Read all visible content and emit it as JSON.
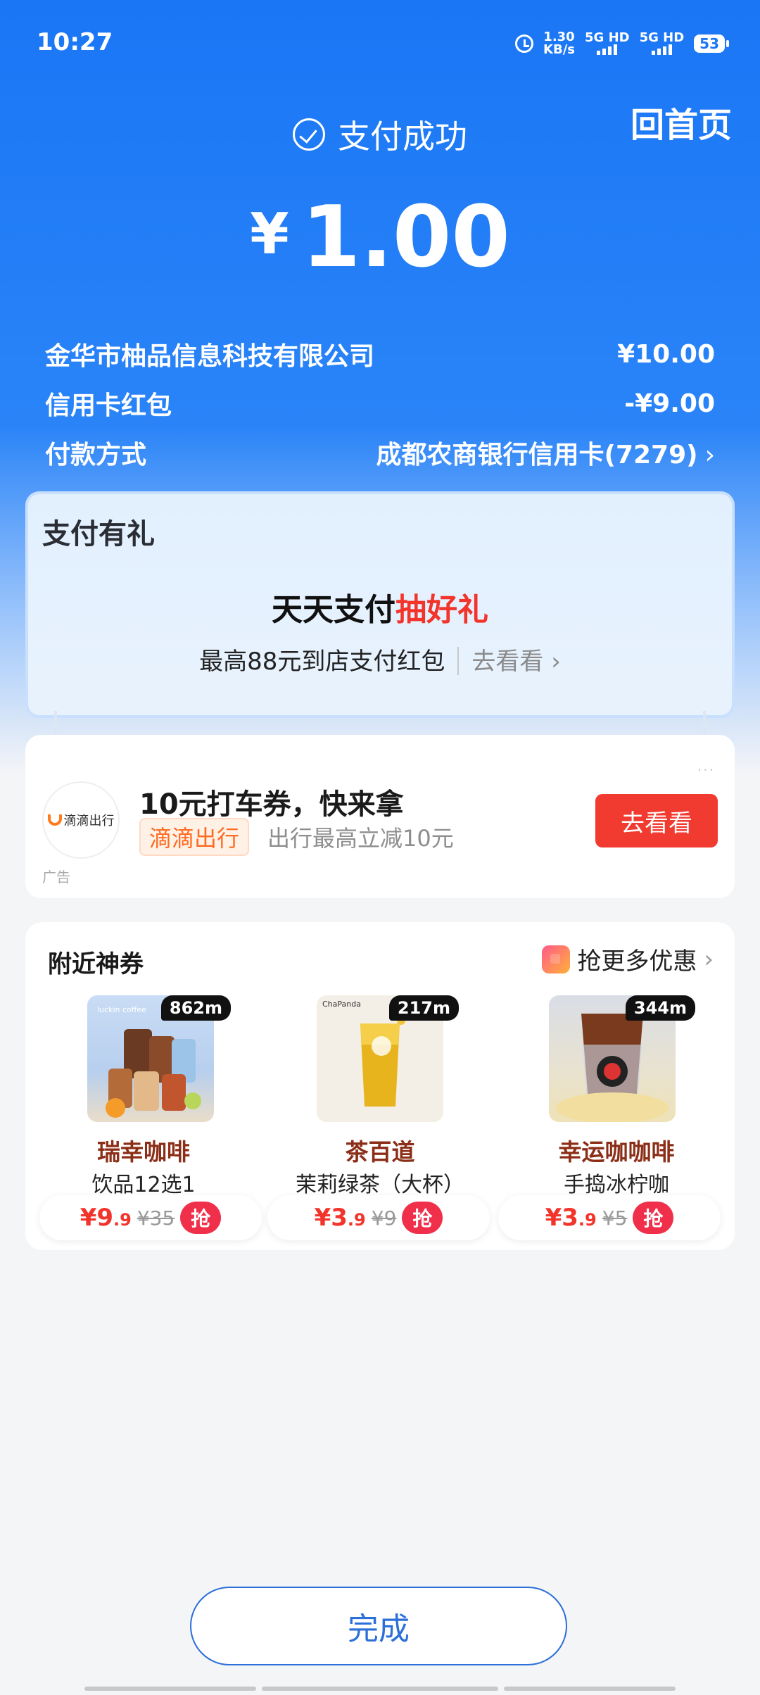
{
  "status": {
    "time": "10:27",
    "speed_value": "1.30",
    "speed_unit": "KB/s",
    "net1": "5G HD",
    "net2": "5G HD",
    "battery": "53"
  },
  "header": {
    "home_label": "回首页",
    "success_label": "支付成功",
    "currency": "¥",
    "amount": "1.00"
  },
  "details": [
    {
      "label": "金华市柚品信息科技有限公司",
      "value": "¥10.00"
    },
    {
      "label": "信用卡红包",
      "value": "-¥9.00"
    },
    {
      "label": "付款方式",
      "value": "成都农商银行信用卡(7279)"
    }
  ],
  "gift": {
    "title": "支付有礼",
    "main_a": "天天支付",
    "main_b": "抽好礼",
    "sub": "最高88元到店支付红包",
    "link": "去看看"
  },
  "ad": {
    "dots": "···",
    "logo_text": "滴滴出行",
    "title": "10元打车券，快来拿",
    "tag": "滴滴出行",
    "desc": "出行最高立减10元",
    "button": "去看看",
    "ad_mark": "广告"
  },
  "coupons": {
    "title": "附近神券",
    "more": "抢更多优惠",
    "items": [
      {
        "distance": "862m",
        "brand": "瑞幸咖啡",
        "product": "饮品12选1",
        "price_int": "¥9",
        "price_dec": ".9",
        "orig": "¥35",
        "grab": "抢",
        "thumb_label": "luckin coffee"
      },
      {
        "distance": "217m",
        "brand": "茶百道",
        "product": "茉莉绿茶（大杯）",
        "price_int": "¥3",
        "price_dec": ".9",
        "orig": "¥9",
        "grab": "抢",
        "thumb_label": "ChaPanda"
      },
      {
        "distance": "344m",
        "brand": "幸运咖咖啡",
        "product": "手捣冰柠咖",
        "price_int": "¥3",
        "price_dec": ".9",
        "orig": "¥5",
        "grab": "抢",
        "thumb_label": ""
      }
    ]
  },
  "footer": {
    "done": "完成"
  },
  "colors": {
    "primary_blue": "#1a76f5",
    "red": "#f2342b",
    "done_blue": "#2b6fd8"
  }
}
